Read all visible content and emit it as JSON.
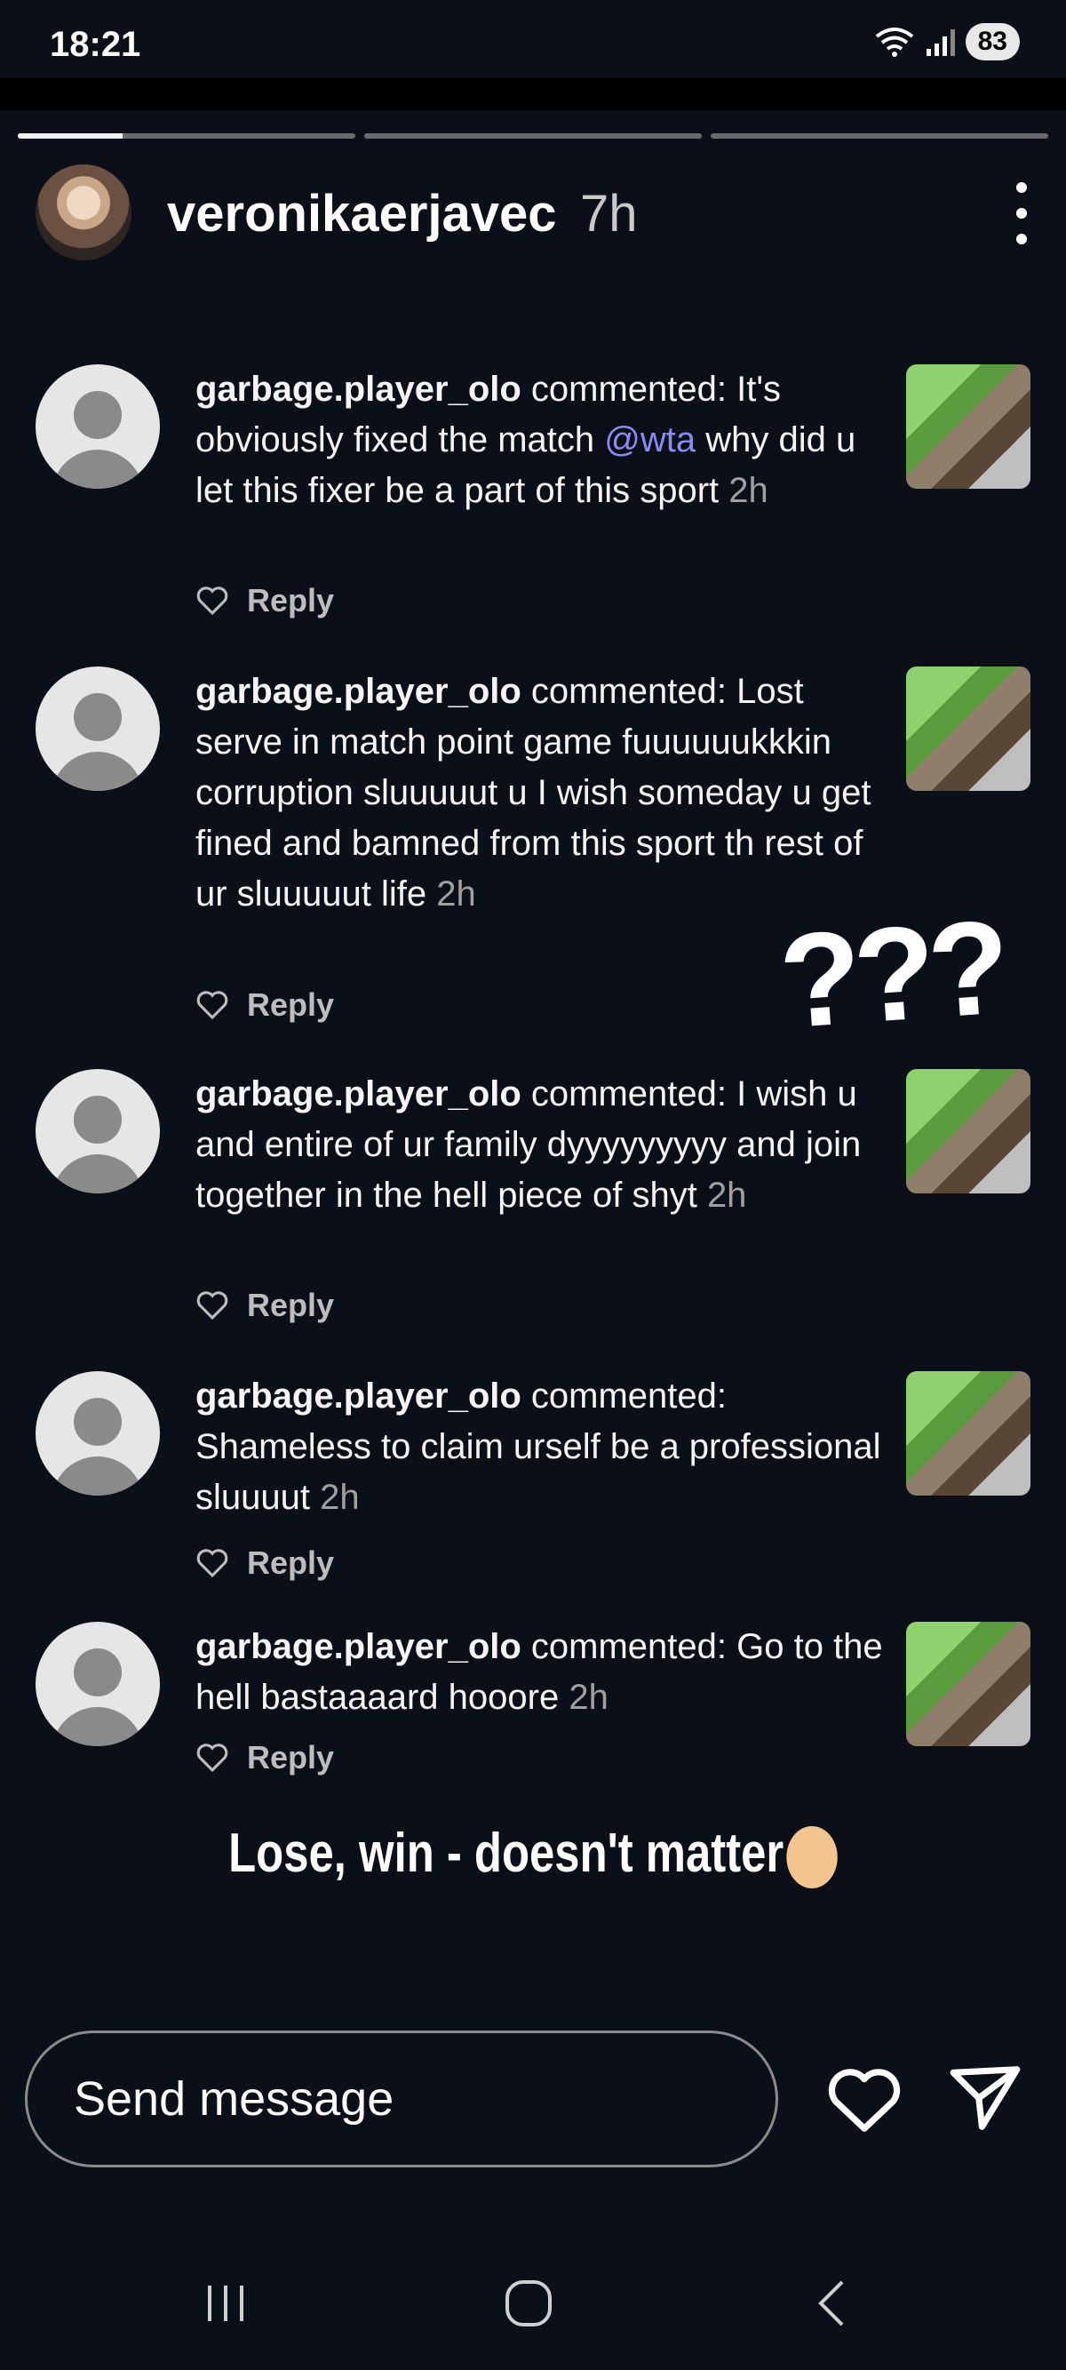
{
  "status_bar": {
    "time": "18:21",
    "battery": "83"
  },
  "story": {
    "progress": [
      0.31,
      0,
      0
    ],
    "username": "veronikaerjavec",
    "time_ago": "7h"
  },
  "comments": [
    {
      "user": "garbage.player_olo",
      "verb": " commented: ",
      "text_before": "It's obviously fixed the match ",
      "mention": "@wta",
      "text_after": " why did u let this fixer be a part of this sport",
      "time": "2h",
      "reply": "Reply"
    },
    {
      "user": "garbage.player_olo",
      "verb": " commented: ",
      "text_before": "Lost serve in match point game fuuuuuukkkin corruption sluuuuut u I wish someday u get fined and bamned from this sport th rest of ur sluuuuut life",
      "mention": "",
      "text_after": "",
      "time": "2h",
      "reply": "Reply"
    },
    {
      "user": "garbage.player_olo",
      "verb": " commented: ",
      "text_before": "I wish u and entire of ur family dyyyyyyyyy and join together in the hell piece of shyt",
      "mention": "",
      "text_after": "",
      "time": "2h",
      "reply": "Reply"
    },
    {
      "user": "garbage.player_olo",
      "verb": " commented: ",
      "text_before": "Shameless to claim urself be a professional sluuuut",
      "mention": "",
      "text_after": "",
      "time": "2h",
      "reply": "Reply"
    },
    {
      "user": "garbage.player_olo",
      "verb": " commented: ",
      "text_before": "Go to the hell bastaaaard hooore",
      "mention": "",
      "text_after": "",
      "time": "2h",
      "reply": "Reply"
    }
  ],
  "overlay": {
    "question_marks": "???",
    "caption": "Lose, win - doesn't matter"
  },
  "message_bar": {
    "placeholder": "Send message"
  },
  "icons": {
    "more": "more-vertical-icon",
    "heart": "heart-icon",
    "send": "send-icon",
    "recents": "recents-icon",
    "home": "home-icon",
    "back": "back-icon",
    "caption_emoji": "person-shrugging-emoji"
  },
  "colors": {
    "background": "#0b0f17",
    "mention": "#8a8cf6"
  }
}
